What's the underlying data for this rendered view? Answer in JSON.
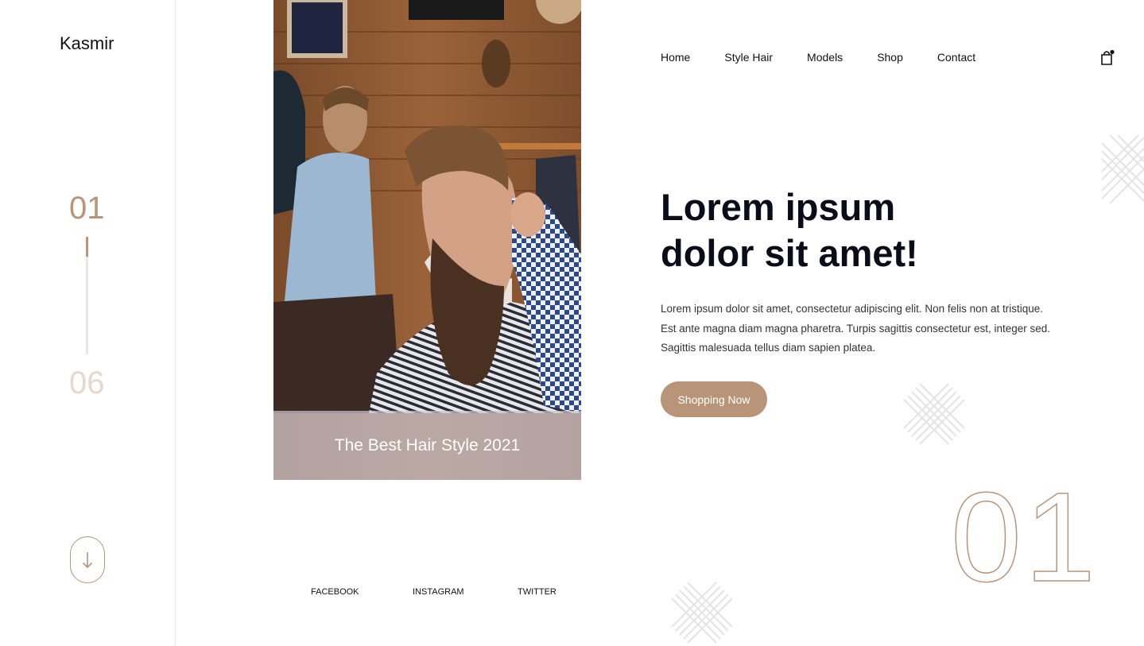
{
  "brand": {
    "name": "Kasmir"
  },
  "slider": {
    "current": "01",
    "total": "06",
    "progress": 0.17
  },
  "nav": {
    "items": [
      {
        "label": "Home"
      },
      {
        "label": "Style Hair"
      },
      {
        "label": "Models"
      },
      {
        "label": "Shop"
      },
      {
        "label": "Contact"
      }
    ]
  },
  "hero": {
    "caption": "The Best Hair Style 2021",
    "headline_line1": "Lorem ipsum",
    "headline_line2": "dolor sit amet!",
    "description": "Lorem ipsum dolor sit amet, consectetur adipiscing elit. Non felis non at tristique. Est ante magna diam magna pharetra. Turpis sagittis consectetur est, integer sed. Sagittis malesuada tellus diam sapien platea.",
    "cta_label": "Shopping Now",
    "big_number": "01"
  },
  "social": [
    {
      "label": "FACEBOOK"
    },
    {
      "label": "INSTAGRAM"
    },
    {
      "label": "TWITTER"
    }
  ],
  "icons": {
    "cart": "shopping-bag-icon",
    "scroll": "arrow-down-icon"
  },
  "colors": {
    "accent": "#b89478",
    "accent_light": "#e6d8cd",
    "text_dark": "#0b0b1a"
  }
}
